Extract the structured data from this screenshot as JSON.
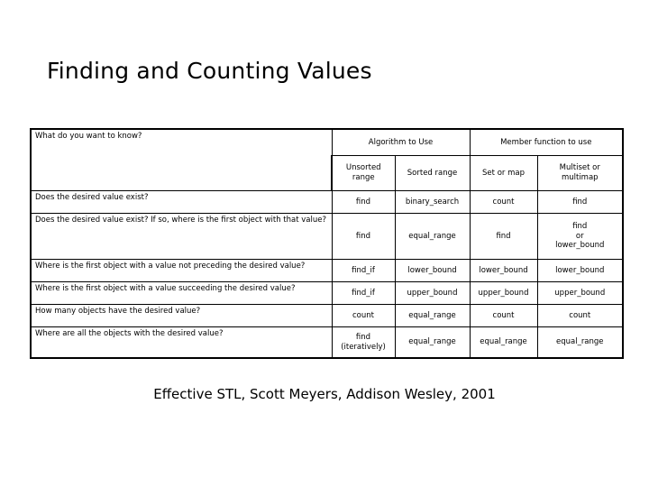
{
  "slide": {
    "title": "Finding and Counting Values",
    "footer": "Effective STL, Scott Meyers, Addison Wesley, 2001",
    "header_bg": "#dcdcdc",
    "border_color": "#000000",
    "background": "#ffffff"
  },
  "table": {
    "question_header": "What do you want to know?",
    "group_headers": [
      {
        "label": "Algorithm to Use",
        "span": 2
      },
      {
        "label": "Member function to use",
        "span": 2
      }
    ],
    "sub_headers": [
      "Unsorted range",
      "Sorted range",
      "Set or map",
      "Multiset or multimap"
    ],
    "rows": [
      {
        "question": "Does the desired value exist?",
        "unsorted_range": "find",
        "sorted_range": "binary_search",
        "set_or_map": "count",
        "multiset_or_multimap": "find"
      },
      {
        "question": "Does the desired value exist?  If so, where is the first object with that value?",
        "unsorted_range": "find",
        "sorted_range": "equal_range",
        "set_or_map": "find",
        "multiset_or_multimap": "find\nor\nlower_bound"
      },
      {
        "question": "Where is the first object with a value not preceding the desired value?",
        "unsorted_range": "find_if",
        "sorted_range": "lower_bound",
        "set_or_map": "lower_bound",
        "multiset_or_multimap": "lower_bound"
      },
      {
        "question": "Where is the first object with a value succeeding the desired value?",
        "unsorted_range": "find_if",
        "sorted_range": "upper_bound",
        "set_or_map": "upper_bound",
        "multiset_or_multimap": "upper_bound"
      },
      {
        "question": "How many objects have the desired value?",
        "unsorted_range": "count",
        "sorted_range": "equal_range",
        "set_or_map": "count",
        "multiset_or_multimap": "count"
      },
      {
        "question": "Where are all the objects with the desired value?",
        "unsorted_range": "find\n(iteratively)",
        "sorted_range": "equal_range",
        "set_or_map": "equal_range",
        "multiset_or_multimap": "equal_range"
      }
    ]
  }
}
